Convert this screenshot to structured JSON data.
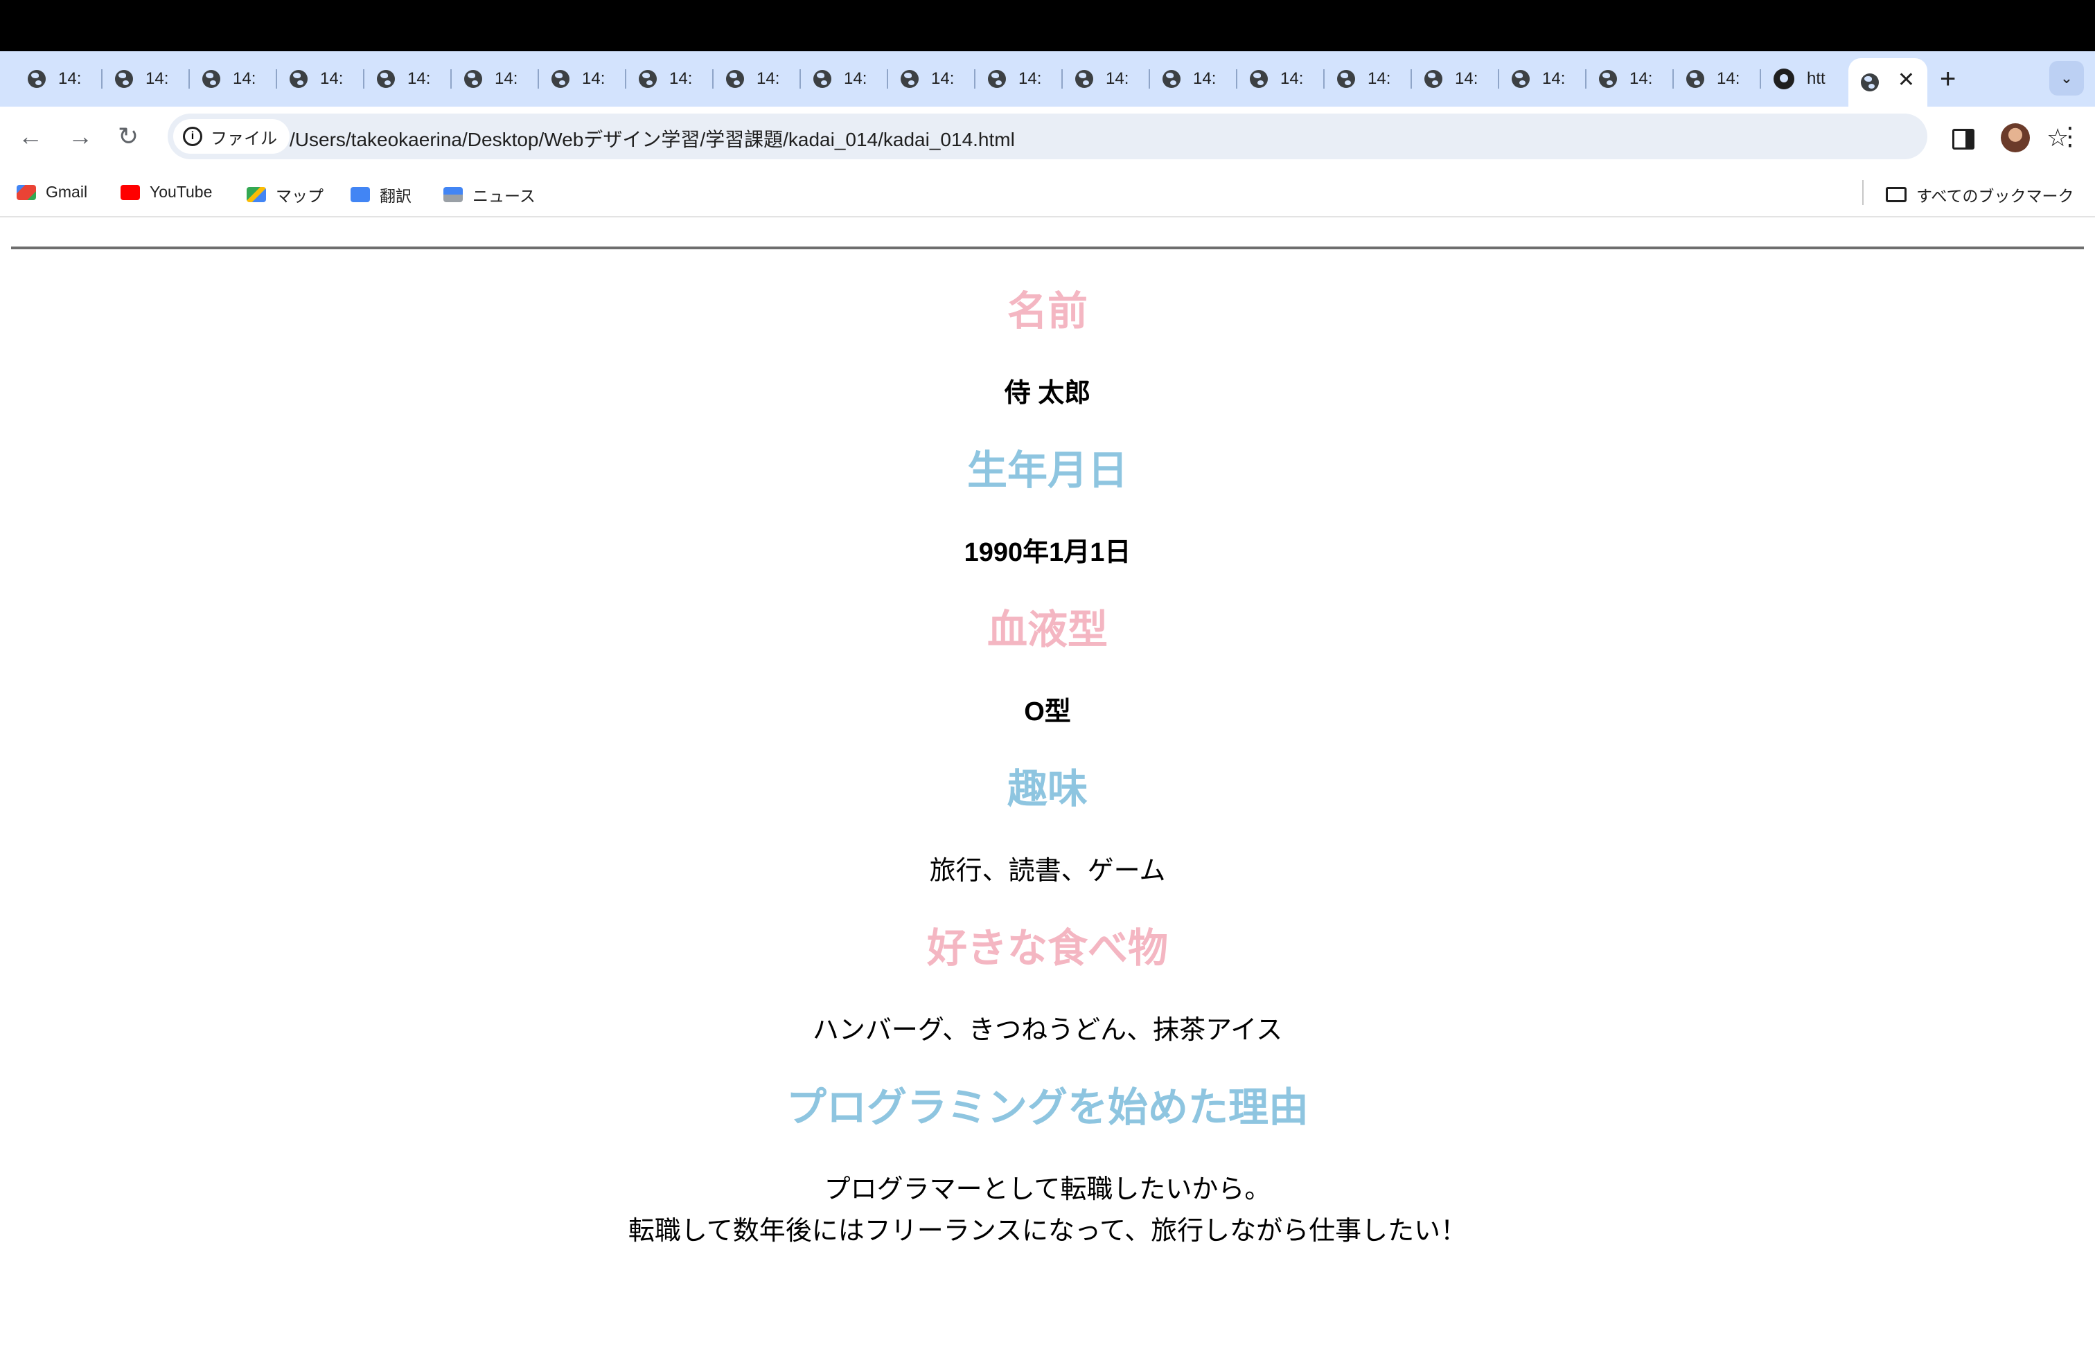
{
  "browser": {
    "tabs": [
      {
        "title": "14:"
      },
      {
        "title": "14:"
      },
      {
        "title": "14:"
      },
      {
        "title": "14:"
      },
      {
        "title": "14:"
      },
      {
        "title": "14:"
      },
      {
        "title": "14:"
      },
      {
        "title": "14:"
      },
      {
        "title": "14:"
      },
      {
        "title": "14:"
      },
      {
        "title": "14:"
      },
      {
        "title": "14:"
      },
      {
        "title": "14:"
      },
      {
        "title": "14:"
      },
      {
        "title": "14:"
      },
      {
        "title": "14:"
      },
      {
        "title": "14:"
      },
      {
        "title": "14:"
      },
      {
        "title": "14:"
      },
      {
        "title": "14:"
      },
      {
        "title": "htt"
      }
    ],
    "active_tab_close": "✕",
    "new_tab_label": "+",
    "tab_menu_label": "⌄",
    "nav": {
      "back": "←",
      "forward": "→",
      "reload": "↻"
    },
    "site_info_label": "ファイル",
    "url": "/Users/takeokaerina/Desktop/Webデザイン学習/学習課題/kadai_014/kadai_014.html",
    "star": "☆",
    "menu": "⋮",
    "bookmarks": [
      {
        "label": "Gmail",
        "icon": "gmail-icon",
        "color": "#ea4335"
      },
      {
        "label": "YouTube",
        "icon": "youtube-icon",
        "color": "#ff0000"
      },
      {
        "label": "マップ",
        "icon": "maps-icon",
        "color": "#34a853"
      },
      {
        "label": "翻訳",
        "icon": "translate-icon",
        "color": "#4285f4"
      },
      {
        "label": "ニュース",
        "icon": "news-icon",
        "color": "#4285f4"
      }
    ],
    "all_bookmarks_label": "すべてのブックマーク"
  },
  "page": {
    "colors": {
      "pink": "#f4b6c2",
      "blue": "#8ec5e0"
    },
    "profile": [
      {
        "heading": "名前",
        "value": "侍 太郎"
      },
      {
        "heading": "生年月日",
        "value": "1990年1月1日"
      },
      {
        "heading": "血液型",
        "value": "O型"
      },
      {
        "heading": "趣味",
        "value": "旅行、読書、ゲーム"
      },
      {
        "heading": "好きな食べ物",
        "value": "ハンバーグ、きつねうどん、抹茶アイス"
      },
      {
        "heading": "プログラミングを始めた理由",
        "value_line1": "プログラマーとして転職したいから。",
        "value_line2": "転職して数年後にはフリーランスになって、旅行しながら仕事したい！"
      }
    ]
  }
}
